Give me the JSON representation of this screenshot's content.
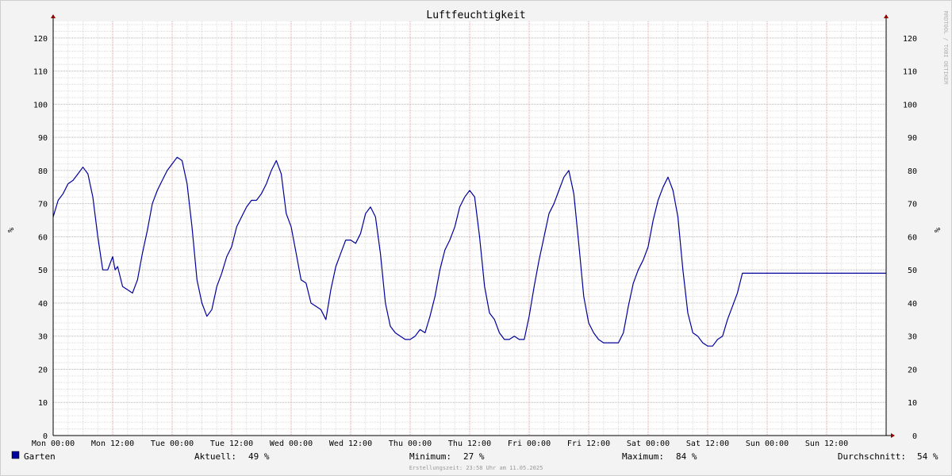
{
  "chart_data": {
    "type": "line",
    "title": "Luftfeuchtigkeit",
    "ylabel": "%",
    "ylabel_right": "%",
    "ylim": [
      0,
      125
    ],
    "y_ticks": [
      0,
      10,
      20,
      30,
      40,
      50,
      60,
      70,
      80,
      90,
      100,
      110,
      120
    ],
    "x_range_hours": [
      0,
      168
    ],
    "x_tick_labels": [
      "Mon 00:00",
      "Mon 12:00",
      "Tue 00:00",
      "Tue 12:00",
      "Wed 00:00",
      "Wed 12:00",
      "Thu 00:00",
      "Thu 12:00",
      "Fri 00:00",
      "Fri 12:00",
      "Sat 00:00",
      "Sat 12:00",
      "Sun 00:00",
      "Sun 12:00"
    ],
    "grid": true,
    "side_text": "RRDTOOL / TOBI OETIKER",
    "series": [
      {
        "name": "Garten",
        "color": "#00009c",
        "x": [
          0,
          1,
          2,
          3,
          4,
          5,
          6,
          7,
          8,
          9,
          10,
          11,
          12,
          12.5,
          13,
          13.5,
          14,
          15,
          16,
          17,
          18,
          19,
          20,
          21,
          22,
          23,
          24,
          25,
          26,
          27,
          28,
          29,
          30,
          31,
          32,
          33,
          34,
          35,
          36,
          37,
          38,
          39,
          40,
          41,
          42,
          43,
          44,
          45,
          46,
          47,
          48,
          49,
          50,
          51,
          52,
          53,
          54,
          55,
          56,
          57,
          58,
          59,
          60,
          61,
          62,
          63,
          64,
          65,
          66,
          67,
          68,
          69,
          70,
          71,
          72,
          73,
          74,
          75,
          76,
          77,
          78,
          79,
          80,
          81,
          82,
          83,
          84,
          85,
          86,
          87,
          88,
          89,
          90,
          91,
          92,
          93,
          94,
          95,
          96,
          97,
          98,
          99,
          100,
          101,
          102,
          103,
          104,
          105,
          106,
          107,
          108,
          109,
          110,
          111,
          112,
          113,
          114,
          115,
          116,
          117,
          118,
          119,
          120,
          121,
          122,
          123,
          124,
          125,
          126,
          127,
          128,
          129,
          130,
          131,
          132,
          133,
          134,
          135,
          136,
          137,
          138,
          139,
          140,
          141,
          142,
          143,
          144,
          145,
          146,
          147,
          148,
          149,
          150,
          151,
          152,
          153,
          154,
          155,
          156,
          157,
          158,
          159,
          160,
          161,
          162,
          163,
          164,
          165,
          166,
          167,
          168
        ],
        "values": [
          66,
          71,
          73,
          76,
          77,
          79,
          81,
          79,
          72,
          60,
          50,
          50,
          54,
          50,
          51,
          48,
          45,
          44,
          43,
          47,
          55,
          62,
          70,
          74,
          77,
          80,
          82,
          84,
          83,
          76,
          63,
          47,
          40,
          36,
          38,
          45,
          49,
          54,
          57,
          63,
          66,
          69,
          71,
          71,
          73,
          76,
          80,
          83,
          79,
          67,
          63,
          55,
          47,
          46,
          40,
          39,
          38,
          35,
          44,
          51,
          55,
          59,
          59,
          58,
          61,
          67,
          69,
          66,
          55,
          40,
          33,
          31,
          30,
          29,
          29,
          30,
          32,
          31,
          36,
          42,
          50,
          56,
          59,
          63,
          69,
          72,
          74,
          72,
          60,
          45,
          37,
          35,
          31,
          29,
          29,
          30,
          29,
          29,
          36,
          45,
          53,
          60,
          67,
          70,
          74,
          78,
          80,
          73,
          58,
          42,
          34,
          31,
          29,
          28,
          28,
          28,
          28,
          31,
          39,
          46,
          50,
          53,
          57,
          65,
          71,
          75,
          78,
          74,
          66,
          50,
          37,
          31,
          30,
          28,
          27,
          27,
          29,
          30,
          35,
          39,
          43,
          49,
          49,
          49,
          49,
          49,
          49,
          49,
          49,
          49,
          49,
          49,
          49,
          49,
          49,
          49,
          49,
          49,
          49,
          49,
          49,
          49,
          49,
          49,
          49,
          49,
          49,
          49,
          49,
          49,
          49
        ]
      }
    ]
  },
  "legend": {
    "series_name": "Garten",
    "series_color": "#00009c",
    "aktuell_label": "Aktuell:",
    "aktuell_value": "49 %",
    "minimum_label": "Minimum:",
    "minimum_value": "27 %",
    "maximum_label": "Maximum:",
    "maximum_value": "84 %",
    "durchschnitt_label": "Durchschnitt:",
    "durchschnitt_value": "54 %"
  },
  "footer": {
    "erstellungszeit": "Erstellungszeit: 23:58 Uhr am 11.05.2025"
  },
  "colors": {
    "background": "#f3f3f3",
    "plot_background": "#ffffff",
    "major_grid": "#e8a0a0",
    "minor_grid": "#dddddd",
    "axis": "#8b0000"
  }
}
